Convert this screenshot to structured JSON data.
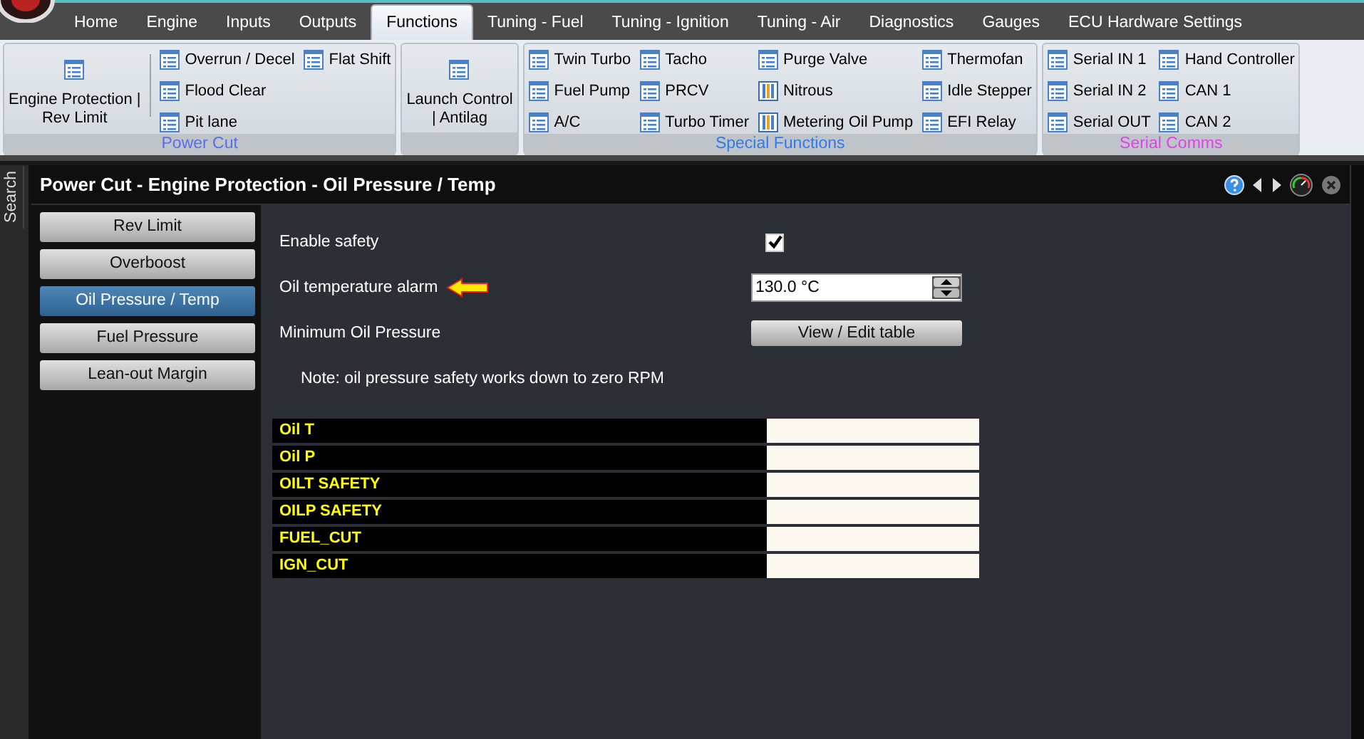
{
  "tabs": [
    {
      "label": "Home",
      "selected": false
    },
    {
      "label": "Engine",
      "selected": false
    },
    {
      "label": "Inputs",
      "selected": false
    },
    {
      "label": "Outputs",
      "selected": false
    },
    {
      "label": "Functions",
      "selected": true
    },
    {
      "label": "Tuning - Fuel",
      "selected": false
    },
    {
      "label": "Tuning - Ignition",
      "selected": false
    },
    {
      "label": "Tuning - Air",
      "selected": false
    },
    {
      "label": "Diagnostics",
      "selected": false
    },
    {
      "label": "Gauges",
      "selected": false
    },
    {
      "label": "ECU Hardware Settings",
      "selected": false
    }
  ],
  "ribbon": [
    {
      "label": "Power Cut",
      "color": "#5a6cf0",
      "large": [
        {
          "lines": [
            "Engine Protection |",
            "Rev Limit"
          ]
        }
      ],
      "columns": [
        [
          {
            "label": "Overrun / Decel",
            "kind": "list"
          },
          {
            "label": "Flood Clear",
            "kind": "list"
          },
          {
            "label": "Pit lane",
            "kind": "list"
          }
        ],
        [
          {
            "label": "Flat Shift",
            "kind": "list"
          }
        ]
      ]
    },
    {
      "large": [
        {
          "lines": [
            "Launch Control",
            "| Antilag"
          ]
        }
      ]
    },
    {
      "label": "Special Functions",
      "color": "#2f7af0",
      "columns": [
        [
          {
            "label": "Twin Turbo",
            "kind": "list"
          },
          {
            "label": "Fuel Pump",
            "kind": "list"
          },
          {
            "label": "A/C",
            "kind": "list"
          }
        ],
        [
          {
            "label": "Tacho",
            "kind": "list"
          },
          {
            "label": "PRCV",
            "kind": "list"
          },
          {
            "label": "Turbo Timer",
            "kind": "list"
          }
        ],
        [
          {
            "label": "Purge Valve",
            "kind": "list"
          },
          {
            "label": "Nitrous",
            "kind": "table"
          },
          {
            "label": "Metering Oil Pump",
            "kind": "table"
          }
        ],
        [
          {
            "label": "Thermofan",
            "kind": "list"
          },
          {
            "label": "Idle Stepper",
            "kind": "list"
          },
          {
            "label": "EFI Relay",
            "kind": "list"
          }
        ]
      ]
    },
    {
      "label": "Serial Comms",
      "color": "#e040f0",
      "columns": [
        [
          {
            "label": "Serial IN 1",
            "kind": "list"
          },
          {
            "label": "Serial IN 2",
            "kind": "list"
          },
          {
            "label": "Serial OUT",
            "kind": "list"
          }
        ],
        [
          {
            "label": "Hand Controller",
            "kind": "list"
          },
          {
            "label": "CAN 1",
            "kind": "list"
          },
          {
            "label": "CAN 2",
            "kind": "list"
          }
        ]
      ]
    }
  ],
  "side_tab": "Search",
  "panel": {
    "title": "Power Cut - Engine Protection - Oil Pressure / Temp"
  },
  "nav": [
    {
      "label": "Rev Limit",
      "selected": false
    },
    {
      "label": "Overboost",
      "selected": false
    },
    {
      "label": "Oil Pressure / Temp",
      "selected": true
    },
    {
      "label": "Fuel Pressure",
      "selected": false
    },
    {
      "label": "Lean-out Margin",
      "selected": false
    }
  ],
  "settings": [
    {
      "label": "Enable safety",
      "kind": "checkbox",
      "checked": true,
      "arrow": false
    },
    {
      "label": "Oil temperature alarm",
      "kind": "number",
      "value": "130.0 °C",
      "arrow": true
    },
    {
      "label": "Minimum Oil Pressure",
      "kind": "button",
      "button": "View / Edit table",
      "arrow": false
    }
  ],
  "note": "Note: oil pressure safety works down to zero RPM",
  "table": {
    "rows": [
      {
        "label": "Oil T"
      },
      {
        "label": "Oil P"
      },
      {
        "label": "OILT SAFETY"
      },
      {
        "label": "OILP SAFETY"
      },
      {
        "label": "FUEL_CUT"
      },
      {
        "label": "IGN_CUT"
      }
    ]
  }
}
